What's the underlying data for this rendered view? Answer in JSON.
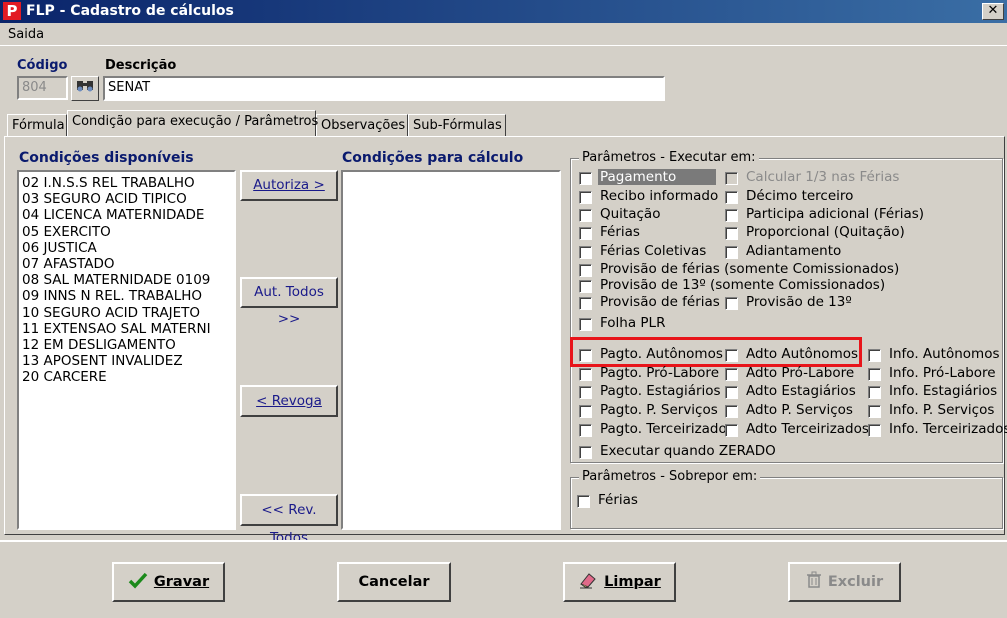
{
  "window": {
    "title": "FLP - Cadastro de cálculos",
    "close_glyph": "✕"
  },
  "menu": {
    "items": [
      "Saida"
    ]
  },
  "header": {
    "codigo_label": "Código",
    "codigo_value": "804",
    "descricao_label": "Descrição",
    "descricao_value": "SENAT"
  },
  "tabs": [
    {
      "label": "Fórmula"
    },
    {
      "label": "Condição para execução / Parâmetros"
    },
    {
      "label": "Observações"
    },
    {
      "label": "Sub-Fórmulas"
    }
  ],
  "available_conditions": {
    "title": "Condições disponíveis",
    "items": [
      "02 I.N.S.S REL TRABALHO",
      "03 SEGURO ACID TIPICO",
      "04 LICENCA MATERNIDADE",
      "05 EXERCITO",
      "06 JUSTICA",
      "07 AFASTADO",
      "08 SAL MATERNIDADE 0109",
      "09 INNS N REL. TRABALHO",
      "10 SEGURO ACID TRAJETO",
      "11 EXTENSAO SAL MATERNI",
      "12 EM DESLIGAMENTO",
      "13 APOSENT  INVALIDEZ",
      "20 CARCERE"
    ]
  },
  "calc_conditions": {
    "title": "Condições para cálculo",
    "items": []
  },
  "transfer_buttons": {
    "autoriza": "Autoriza >",
    "aut_todos": "Aut. Todos >>",
    "revoga": "< Revoga",
    "rev_todos": "<< Rev. Todos"
  },
  "params_execute": {
    "legend": "Parâmetros - Executar em:",
    "pagamento": "Pagamento",
    "calcular_terco": "Calcular 1/3 nas Férias",
    "recibo": "Recibo informado",
    "decimo": "Décimo terceiro",
    "quitacao": "Quitação",
    "participa": "Participa adicional (Férias)",
    "ferias": "Férias",
    "proporcional": "Proporcional (Quitação)",
    "ferias_coletivas": "Férias Coletivas",
    "adiantamento": "Adiantamento",
    "provisao_ferias_com": "Provisão de férias (somente Comissionados)",
    "provisao_13_com": "Provisão de 13º (somente Comissionados)",
    "provisao_ferias": "Provisão de férias",
    "provisao_13": "Provisão de 13º",
    "folha_plr": "Folha PLR",
    "pagto_autonomos": "Pagto. Autônomos",
    "adto_autonomos": "Adto Autônomos",
    "info_autonomos": "Info. Autônomos",
    "pagto_prolabore": "Pagto. Pró-Labore",
    "adto_prolabore": "Adto Pró-Labore",
    "info_prolabore": "Info. Pró-Labore",
    "pagto_estagiarios": "Pagto. Estagiários",
    "adto_estagiarios": "Adto Estagiários",
    "info_estagiarios": "Info. Estagiários",
    "pagto_servicos": "Pagto. P. Serviços",
    "adto_servicos": "Adto P. Serviços",
    "info_servicos": "Info. P. Serviços",
    "pagto_terceirizado": "Pagto. Terceirizado",
    "adto_terceirizados": "Adto Terceirizados",
    "info_terceirizados": "Info. Terceirizados",
    "executar_zerado": "Executar quando ZERADO"
  },
  "params_override": {
    "legend": "Parâmetros - Sobrepor em:",
    "ferias": "Férias"
  },
  "actions": {
    "gravar": "Gravar",
    "cancelar": "Cancelar",
    "limpar": "Limpar",
    "excluir": "Excluir"
  },
  "colors": {
    "highlight": "#e8141a",
    "title_bar": "#0a246a",
    "header_text": "#0a1a6e"
  }
}
